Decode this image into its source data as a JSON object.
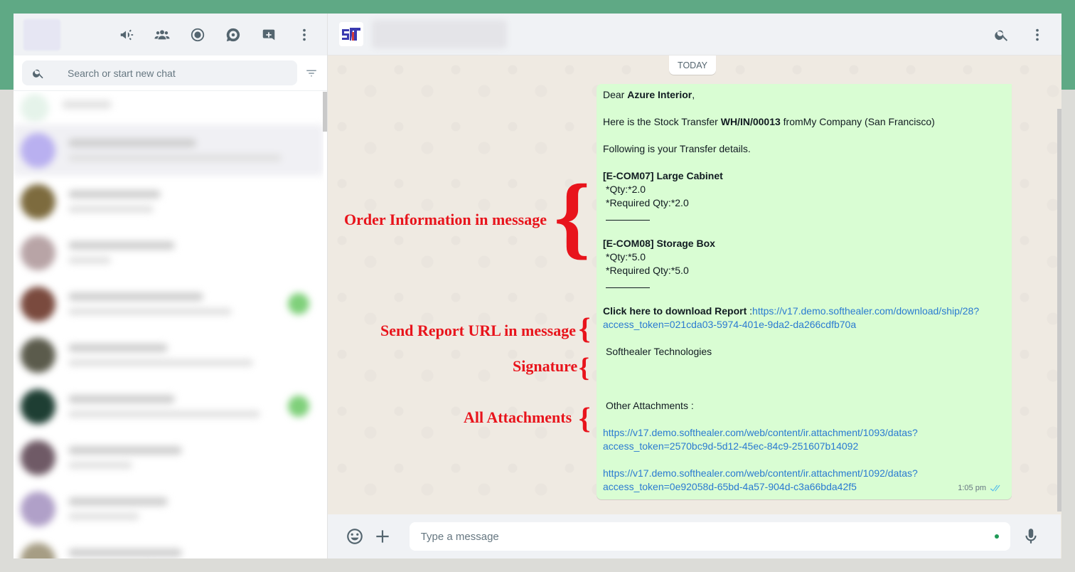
{
  "sidebar": {
    "search_placeholder": "Search or start new chat",
    "header_icons": [
      "communities-icon",
      "people-icon",
      "status-icon",
      "channels-icon",
      "new-chat-icon",
      "menu-icon"
    ]
  },
  "conversation": {
    "day_label": "TODAY",
    "message": {
      "greeting_prefix": "Dear ",
      "customer_name": "Azure Interior",
      "greeting_suffix": ",",
      "intro_prefix": "Here is the Stock Transfer ",
      "transfer_ref": "WH/IN/00013",
      "intro_suffix": " fromMy Company (San Francisco)",
      "details_line": "Following is your Transfer details.",
      "products": [
        {
          "name": "[E-COM07] Large Cabinet",
          "qty": "*Qty:*2.0",
          "required_qty": "*Required Qty:*2.0"
        },
        {
          "name": "[E-COM08] Storage Box",
          "qty": "*Qty:*5.0",
          "required_qty": "*Required Qty:*5.0"
        }
      ],
      "report_label": "Click here to download Report ",
      "report_colon": ":",
      "report_url_line1": "https://v17.demo.softhealer.com/download/ship/28?",
      "report_url_line2": "access_token=021cda03-5974-401e-9da2-da266cdfb70a",
      "signature": "Softhealer Technologies",
      "attachments_label": "Other Attachments :",
      "attachments": [
        {
          "line1": "https://v17.demo.softhealer.com/web/content/ir.attachment/1093/datas?",
          "line2": "access_token=2570bc9d-5d12-45ec-84c9-251607b14092"
        },
        {
          "line1": "https://v17.demo.softhealer.com/web/content/ir.attachment/1092/datas?",
          "line2": "access_token=0e92058d-65bd-4a57-904d-c3a66bda42f5"
        }
      ],
      "time": "1:05 pm"
    }
  },
  "annotations": {
    "order_info": "Order Information in message",
    "report_url": "Send Report URL in message",
    "signature": "Signature",
    "attachments": "All Attachments"
  },
  "composer": {
    "placeholder": "Type a message"
  },
  "colors": {
    "brand_band": "#5fa985",
    "bubble": "#d9fdd3",
    "annotation": "#e8141c",
    "link": "#2a7ad1"
  }
}
